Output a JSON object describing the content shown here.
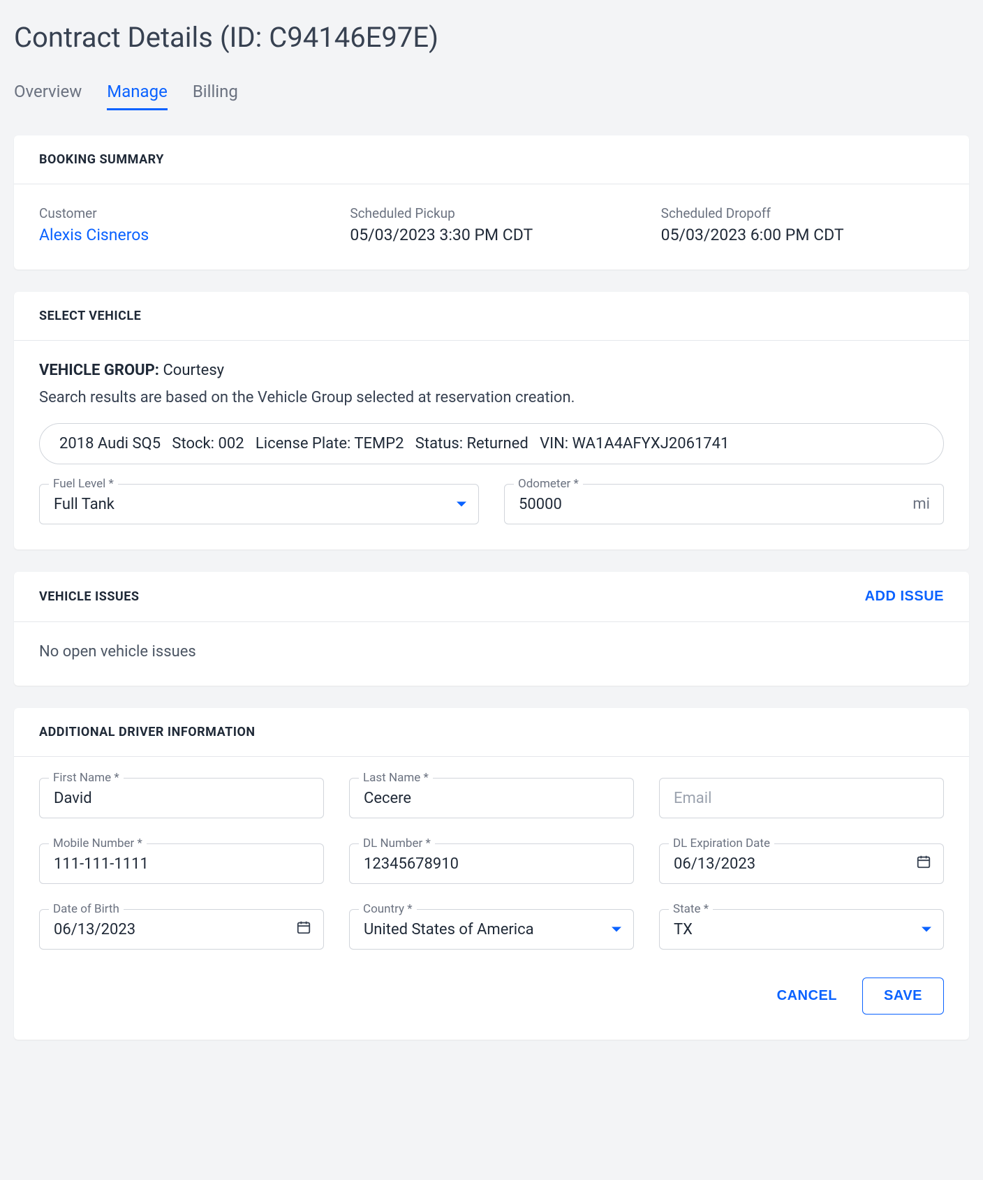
{
  "page": {
    "title": "Contract Details (ID: C94146E97E)"
  },
  "tabs": {
    "overview": "Overview",
    "manage": "Manage",
    "billing": "Billing"
  },
  "booking": {
    "section_title": "BOOKING SUMMARY",
    "customer_label": "Customer",
    "customer_value": "Alexis Cisneros",
    "pickup_label": "Scheduled Pickup",
    "pickup_value": "05/03/2023 3:30 PM CDT",
    "dropoff_label": "Scheduled Dropoff",
    "dropoff_value": "05/03/2023 6:00 PM CDT"
  },
  "vehicle": {
    "section_title": "SELECT VEHICLE",
    "group_label": "VEHICLE GROUP:",
    "group_value": "Courtesy",
    "search_note": "Search results are based on the Vehicle Group selected at reservation creation.",
    "selected_summary": "2018 Audi SQ5   Stock: 002   License Plate: TEMP2   Status: Returned   VIN: WA1A4AFYXJ2061741",
    "fuel_label": "Fuel Level *",
    "fuel_value": "Full Tank",
    "odometer_label": "Odometer *",
    "odometer_value": "50000",
    "odometer_unit": "mi"
  },
  "issues": {
    "section_title": "VEHICLE ISSUES",
    "add_button": "ADD ISSUE",
    "empty_text": "No open vehicle issues"
  },
  "driver": {
    "section_title": "ADDITIONAL DRIVER INFORMATION",
    "first_name_label": "First Name *",
    "first_name_value": "David",
    "last_name_label": "Last Name *",
    "last_name_value": "Cecere",
    "email_placeholder": "Email",
    "email_value": "",
    "mobile_label": "Mobile Number *",
    "mobile_value": "111-111-1111",
    "dl_number_label": "DL Number *",
    "dl_number_value": "12345678910",
    "dl_exp_label": "DL Expiration Date",
    "dl_exp_value": "06/13/2023",
    "dob_label": "Date of Birth",
    "dob_value": "06/13/2023",
    "country_label": "Country *",
    "country_value": "United States of America",
    "state_label": "State *",
    "state_value": "TX"
  },
  "actions": {
    "cancel": "CANCEL",
    "save": "SAVE"
  }
}
